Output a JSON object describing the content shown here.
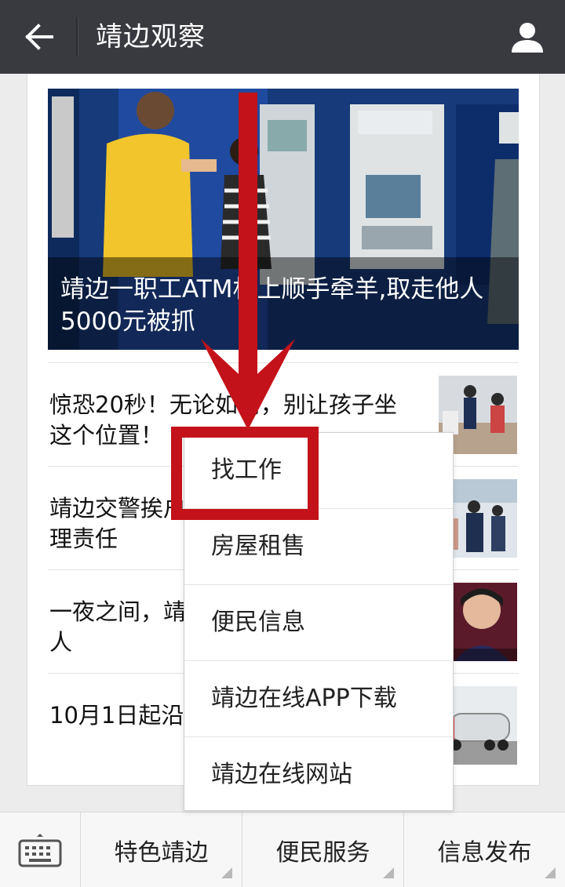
{
  "header": {
    "title": "靖边观察",
    "back_icon": "arrow-left-icon",
    "profile_icon": "person-icon"
  },
  "cover": {
    "title": "靖边一职工ATM机上顺手牵羊,取走他人5000元被抓"
  },
  "articles": [
    {
      "title": "惊恐20秒！无论如何，别让孩子坐这个位置！"
    },
    {
      "title": "靖边交警挨户上门，落实企业安全管理责任"
    },
    {
      "title": "一夜之间，靖边这个从监狱走出来的人"
    },
    {
      "title": "10月1日起沿途出行，犯规就要"
    }
  ],
  "bottom_menu": {
    "keyboard_icon": "keyboard-icon",
    "items": [
      {
        "label": "特色靖边"
      },
      {
        "label": "便民服务"
      },
      {
        "label": "信息发布"
      }
    ]
  },
  "popup_menu": {
    "items": [
      {
        "label": "找工作"
      },
      {
        "label": "房屋租售"
      },
      {
        "label": "便民信息"
      },
      {
        "label": "靖边在线APP下载"
      },
      {
        "label": "靖边在线网站"
      }
    ]
  },
  "colors": {
    "topbar": "#393a3f",
    "annotation_red": "#c4121a",
    "background": "#ececec"
  }
}
